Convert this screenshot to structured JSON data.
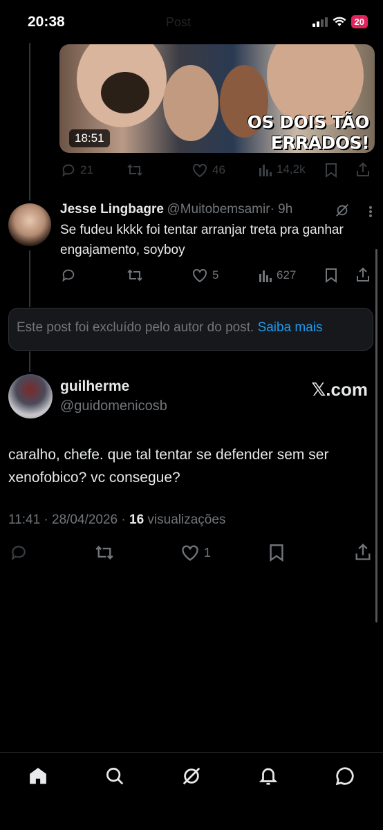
{
  "status_bar": {
    "time": "20:38",
    "battery": "20",
    "header_label": "Post"
  },
  "video_post": {
    "duration": "18:51",
    "overlay_line1": "OS DOIS TÃO",
    "overlay_line2": "ERRADOS!",
    "replies": "21",
    "likes": "46",
    "views": "14,2k"
  },
  "reply": {
    "name": "Jesse Lingbagre",
    "handle": "@Muitobemsamir",
    "time": "· 9h",
    "text": "Se fudeu kkkk foi tentar arranjar treta pra ganhar engajamento, soyboy",
    "likes": "5",
    "views": "627"
  },
  "deleted_notice": {
    "text": "Este post foi excluído pelo autor do post.",
    "link": "Saiba mais"
  },
  "main_post": {
    "name": "guilherme",
    "handle": "@guidomenicosb",
    "watermark": "𝕏.com",
    "text": "caralho, chefe. que tal tentar se defender sem ser xenofobico? vc consegue?",
    "timestamp": "11:41 · 28/04/2026 · ",
    "views_count": "16",
    "views_label": " visualizações",
    "likes": "1"
  },
  "tabs": [
    "home-icon",
    "search-icon",
    "grok-icon",
    "notifications-icon",
    "messages-icon"
  ]
}
